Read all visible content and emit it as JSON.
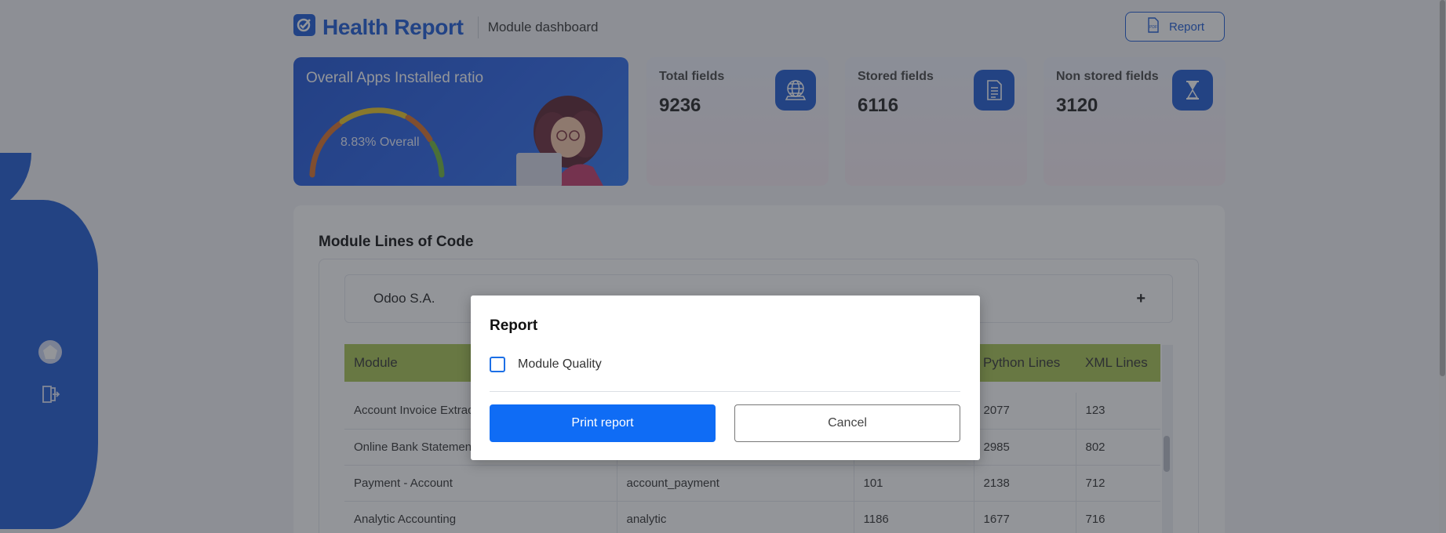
{
  "header": {
    "brand_title": "Health Report",
    "subtitle": "Module dashboard",
    "report_button": "Report"
  },
  "hero": {
    "title": "Overall Apps Installed ratio",
    "value_text": "8.83% Overall",
    "gauge_ratio": 0.0883
  },
  "stats": [
    {
      "label": "Total fields",
      "value": "9236",
      "icon": "globe-icon"
    },
    {
      "label": "Stored fields",
      "value": "6116",
      "icon": "document-icon"
    },
    {
      "label": "Non stored fields",
      "value": "3120",
      "icon": "hourglass-icon"
    }
  ],
  "panel": {
    "title": "Module Lines of Code",
    "vendor": "Odoo S.A.",
    "vendor_toggle": "+"
  },
  "table": {
    "columns": [
      "Module",
      "",
      "",
      "Python Lines",
      "XML Lines"
    ],
    "rows": [
      [
        "Account Invoice Extract",
        "",
        "",
        "2077",
        "123"
      ],
      [
        "Online Bank Statement",
        "",
        "",
        "2985",
        "802"
      ],
      [
        "Payment - Account",
        "account_payment",
        "101",
        "2138",
        "712"
      ],
      [
        "Analytic Accounting",
        "analytic",
        "1186",
        "1677",
        "716"
      ]
    ]
  },
  "modal": {
    "title": "Report",
    "checkbox_label": "Module Quality",
    "checkbox_checked": false,
    "print_button": "Print report",
    "cancel_button": "Cancel"
  },
  "colors": {
    "brand": "#1c5bd6",
    "table_header": "#a8c453",
    "primary_button": "#0f6cf5"
  }
}
